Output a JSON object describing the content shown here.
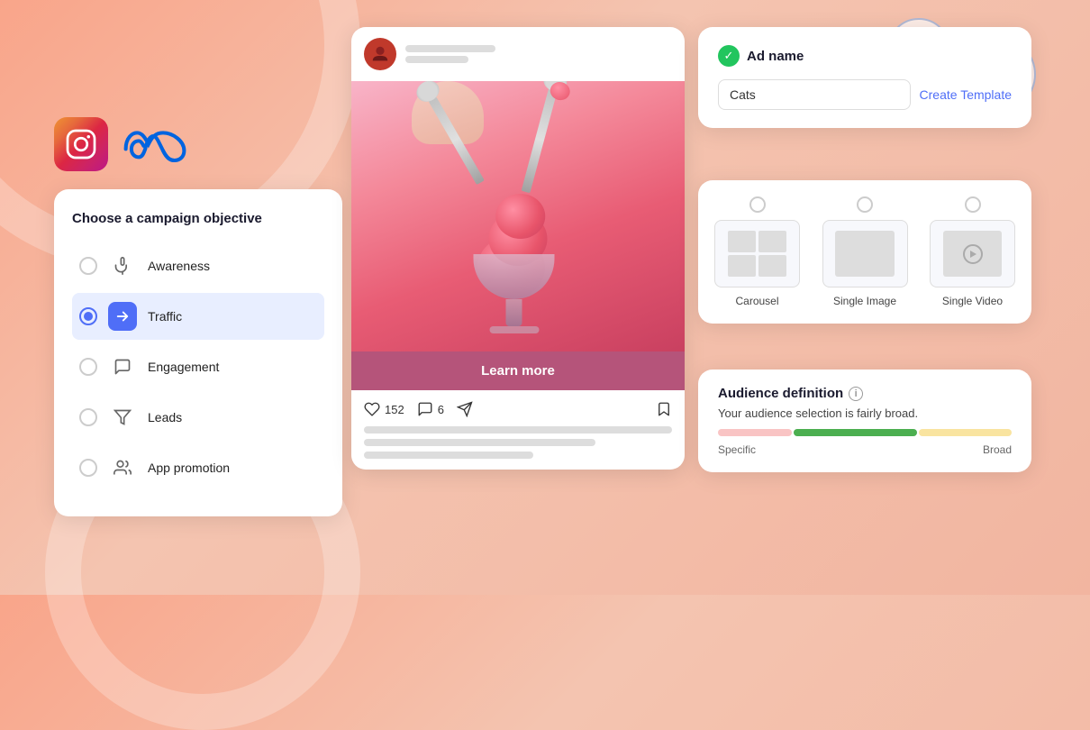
{
  "background": {
    "color_start": "#f9a58a",
    "color_end": "#f2b5a0"
  },
  "social_icons": {
    "instagram_alt": "Instagram",
    "meta_alt": "Meta"
  },
  "top_right": {
    "megaphone_icon": "megaphone-icon",
    "coin_icon": "coin-hand-icon"
  },
  "campaign_panel": {
    "title": "Choose a campaign objective",
    "items": [
      {
        "id": "awareness",
        "label": "Awareness",
        "icon": "megaphone-sm",
        "selected": false,
        "active": false
      },
      {
        "id": "traffic",
        "label": "Traffic",
        "icon": "arrow-icon",
        "selected": true,
        "active": true
      },
      {
        "id": "engagement",
        "label": "Engagement",
        "icon": "chat-icon",
        "selected": false,
        "active": false
      },
      {
        "id": "leads",
        "label": "Leads",
        "icon": "filter-icon",
        "selected": false,
        "active": false
      },
      {
        "id": "app_promotion",
        "label": "App promotion",
        "icon": "people-icon",
        "selected": false,
        "active": false
      }
    ]
  },
  "post_preview": {
    "username_placeholder": "username",
    "learn_more_label": "Learn more",
    "likes_count": "152",
    "comments_count": "6"
  },
  "ad_name_panel": {
    "title": "Ad name",
    "input_value": "Cats",
    "create_template_label": "Create Template"
  },
  "format_panel": {
    "options": [
      {
        "id": "carousel",
        "label": "Carousel",
        "selected": false
      },
      {
        "id": "single_image",
        "label": "Single Image",
        "selected": false
      },
      {
        "id": "single_video",
        "label": "Single Video",
        "selected": false
      }
    ]
  },
  "audience_panel": {
    "title": "Audience definition",
    "description": "Your audience selection is fairly broad.",
    "specific_label": "Specific",
    "broad_label": "Broad"
  }
}
